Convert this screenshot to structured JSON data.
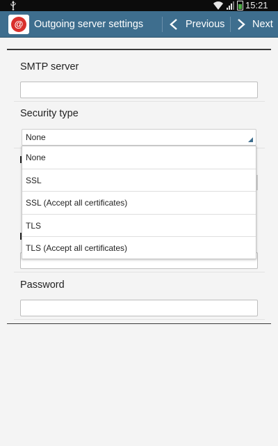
{
  "status_bar": {
    "time": "15:21",
    "icons": [
      "usb-icon",
      "wifi-icon",
      "signal-icon",
      "battery-icon"
    ]
  },
  "action_bar": {
    "app_icon": "email-at-icon",
    "app_icon_glyph": "@",
    "title": "Outgoing server settings",
    "previous_label": "Previous",
    "next_label": "Next"
  },
  "form": {
    "smtp_server": {
      "label": "SMTP server",
      "value": "",
      "placeholder": ""
    },
    "security_type": {
      "label": "Security type",
      "selected": "None",
      "options": [
        "None",
        "SSL",
        "SSL (Accept all certificates)",
        "TLS",
        "TLS (Accept all certificates)"
      ]
    },
    "password": {
      "label": "Password",
      "value": "",
      "placeholder": ""
    }
  },
  "colors": {
    "action_bar": "#3e6e8e",
    "status_bar": "#0c0c0c",
    "background": "#f4f4f4",
    "app_icon_red": "#d9302c"
  }
}
